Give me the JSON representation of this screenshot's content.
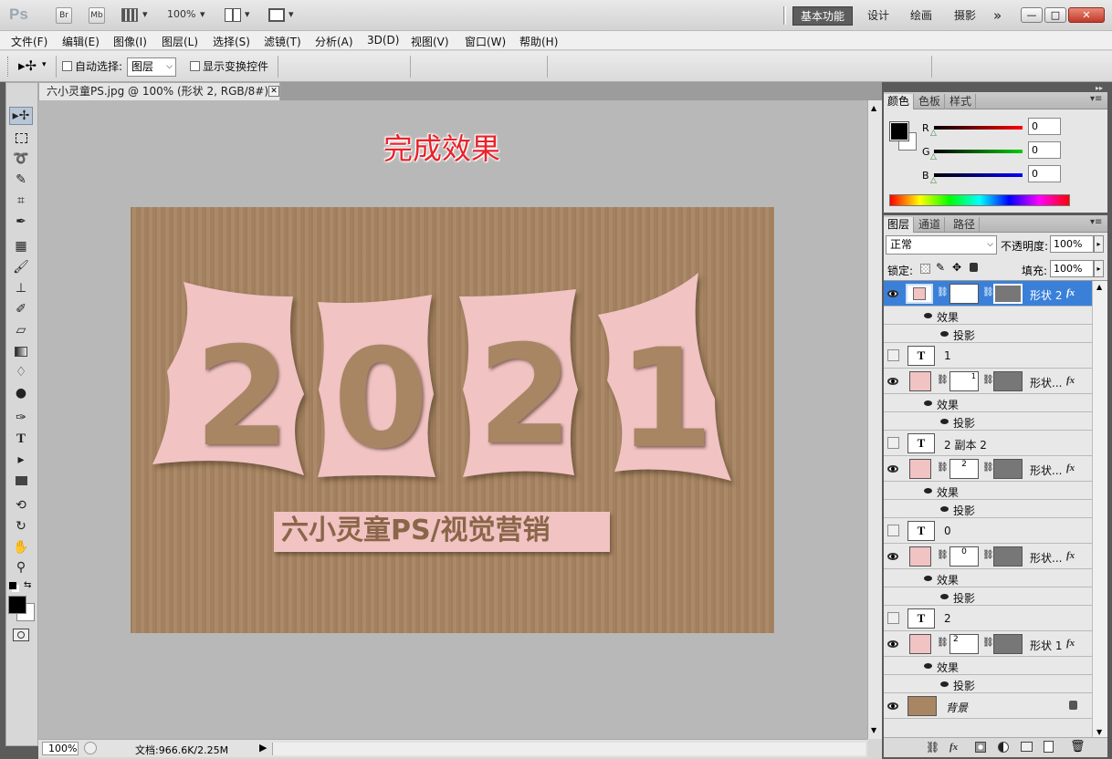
{
  "titlebar": {
    "app_logo": "Ps",
    "br": "Br",
    "mb": "Mb",
    "zoom": "100%",
    "workspaces": [
      "基本功能",
      "设计",
      "绘画",
      "摄影"
    ],
    "more": "»",
    "min": "—",
    "max": "□",
    "close": "✕"
  },
  "menu": [
    "文件(F)",
    "编辑(E)",
    "图像(I)",
    "图层(L)",
    "选择(S)",
    "滤镜(T)",
    "分析(A)",
    "3D(D)",
    "视图(V)",
    "窗口(W)",
    "帮助(H)"
  ],
  "options": {
    "auto_select_label": "自动选择:",
    "auto_select_value": "图层",
    "show_transform_label": "显示变换控件"
  },
  "document": {
    "tab_title": "六小灵童PS.jpg @ 100% (形状 2, RGB/8#) *",
    "caption": "完成效果",
    "year_digits": [
      "2",
      "0",
      "2",
      "1"
    ],
    "banner": "六小灵童PS/视觉营销",
    "status_zoom": "100%",
    "status_doc": "文档:966.6K/2.25M"
  },
  "color_panel": {
    "tabs": [
      "颜色",
      "色板",
      "样式"
    ],
    "r_label": "R",
    "g_label": "G",
    "b_label": "B",
    "r": "0",
    "g": "0",
    "b": "0"
  },
  "layers_panel": {
    "tabs": [
      "图层",
      "通道",
      "路径"
    ],
    "blend_mode": "正常",
    "opacity_label": "不透明度:",
    "opacity": "100%",
    "lock_label": "锁定:",
    "fill_label": "填充:",
    "fill": "100%",
    "effects_label": "效果",
    "shadow_label": "投影",
    "layers": [
      {
        "name": "形状 2",
        "kind": "shape",
        "mask_text": "",
        "visible": true,
        "selected": true
      },
      {
        "name": "1",
        "kind": "text",
        "visible": false
      },
      {
        "name": "形状...",
        "kind": "shape",
        "mask_text": "1",
        "visible": true
      },
      {
        "name": "2 副本 2",
        "kind": "text",
        "visible": false
      },
      {
        "name": "形状...",
        "kind": "shape",
        "mask_text": "2",
        "visible": true
      },
      {
        "name": "0",
        "kind": "text",
        "visible": false
      },
      {
        "name": "形状...",
        "kind": "shape",
        "mask_text": "0",
        "visible": true
      },
      {
        "name": "2",
        "kind": "text",
        "visible": false
      },
      {
        "name": "形状 1",
        "kind": "shape",
        "mask_text": "2",
        "visible": true
      },
      {
        "name": "背景",
        "kind": "background",
        "visible": true
      }
    ],
    "fx_glyph": "fx"
  },
  "colors": {
    "pink": "#f1c3c3",
    "cardboard": "#a88563",
    "caption_red": "#e8232b",
    "banner_text": "#8a6648"
  }
}
